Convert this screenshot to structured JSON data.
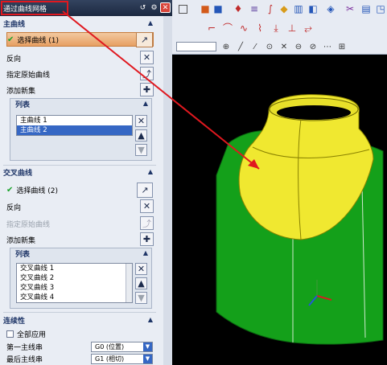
{
  "window": {
    "title": "通过曲线网格"
  },
  "primary_curves": {
    "header": "主曲线",
    "select_curve_label": "选择曲线 (1)",
    "reverse_label": "反向",
    "specify_origin_label": "指定原始曲线",
    "add_new_set_label": "添加新集",
    "list": {
      "header": "列表",
      "items": [
        "主曲线 1",
        "主曲线 2"
      ],
      "selected_index": 1
    }
  },
  "cross_curves": {
    "header": "交叉曲线",
    "select_curve_label": "选择曲线 (2)",
    "reverse_label": "反向",
    "specify_origin_label": "指定原始曲线",
    "add_new_set_label": "添加新集",
    "list": {
      "header": "列表",
      "items": [
        "交叉曲线 1",
        "交叉曲线 2",
        "交叉曲线 3",
        "交叉曲线 4"
      ]
    }
  },
  "continuity": {
    "header": "连续性",
    "apply_all_label": "全部应用",
    "first_primary_label": "第一主线串",
    "first_primary_value": "G0 (位置)",
    "last_primary_label": "最后主线串",
    "last_primary_value": "G1 (相切)"
  },
  "colors": {
    "accent": "#e0181f",
    "selection": "#3567c4",
    "surface_yellow": "#f0e830",
    "surface_green": "#14a01a"
  }
}
